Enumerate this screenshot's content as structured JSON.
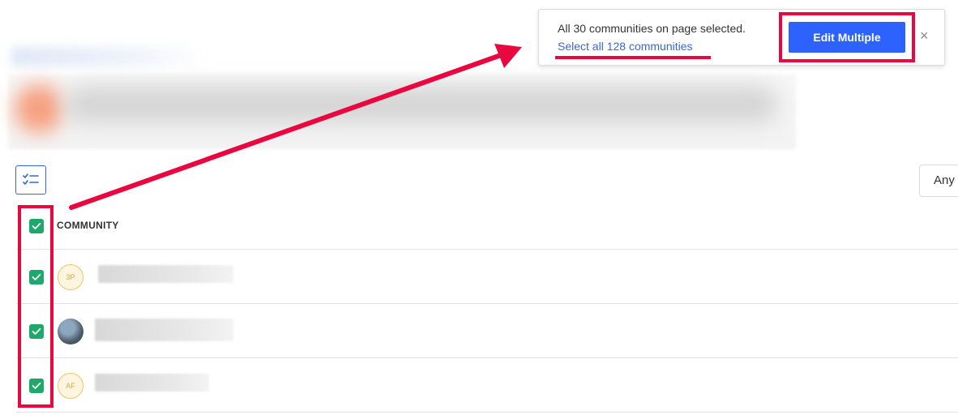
{
  "toast": {
    "message": "All 30 communities on page selected.",
    "select_all_link": "Select all 128 communities",
    "edit_button": "Edit Multiple",
    "close_glyph": "×"
  },
  "toolbar": {
    "multi_select_icon": "checklist-icon",
    "filter_dropdown_label": "Any"
  },
  "table": {
    "column_header": "COMMUNITY",
    "rows": [
      {
        "avatar_text": "3P",
        "avatar_type": "initials"
      },
      {
        "avatar_text": "",
        "avatar_type": "photo"
      },
      {
        "avatar_text": "AF",
        "avatar_type": "initials"
      }
    ]
  },
  "colors": {
    "highlight": "#e8083f",
    "primary_button": "#2d62ff",
    "link": "#3767d5",
    "checkbox": "#1ea86b",
    "avatar_border": "#e8c76a"
  }
}
